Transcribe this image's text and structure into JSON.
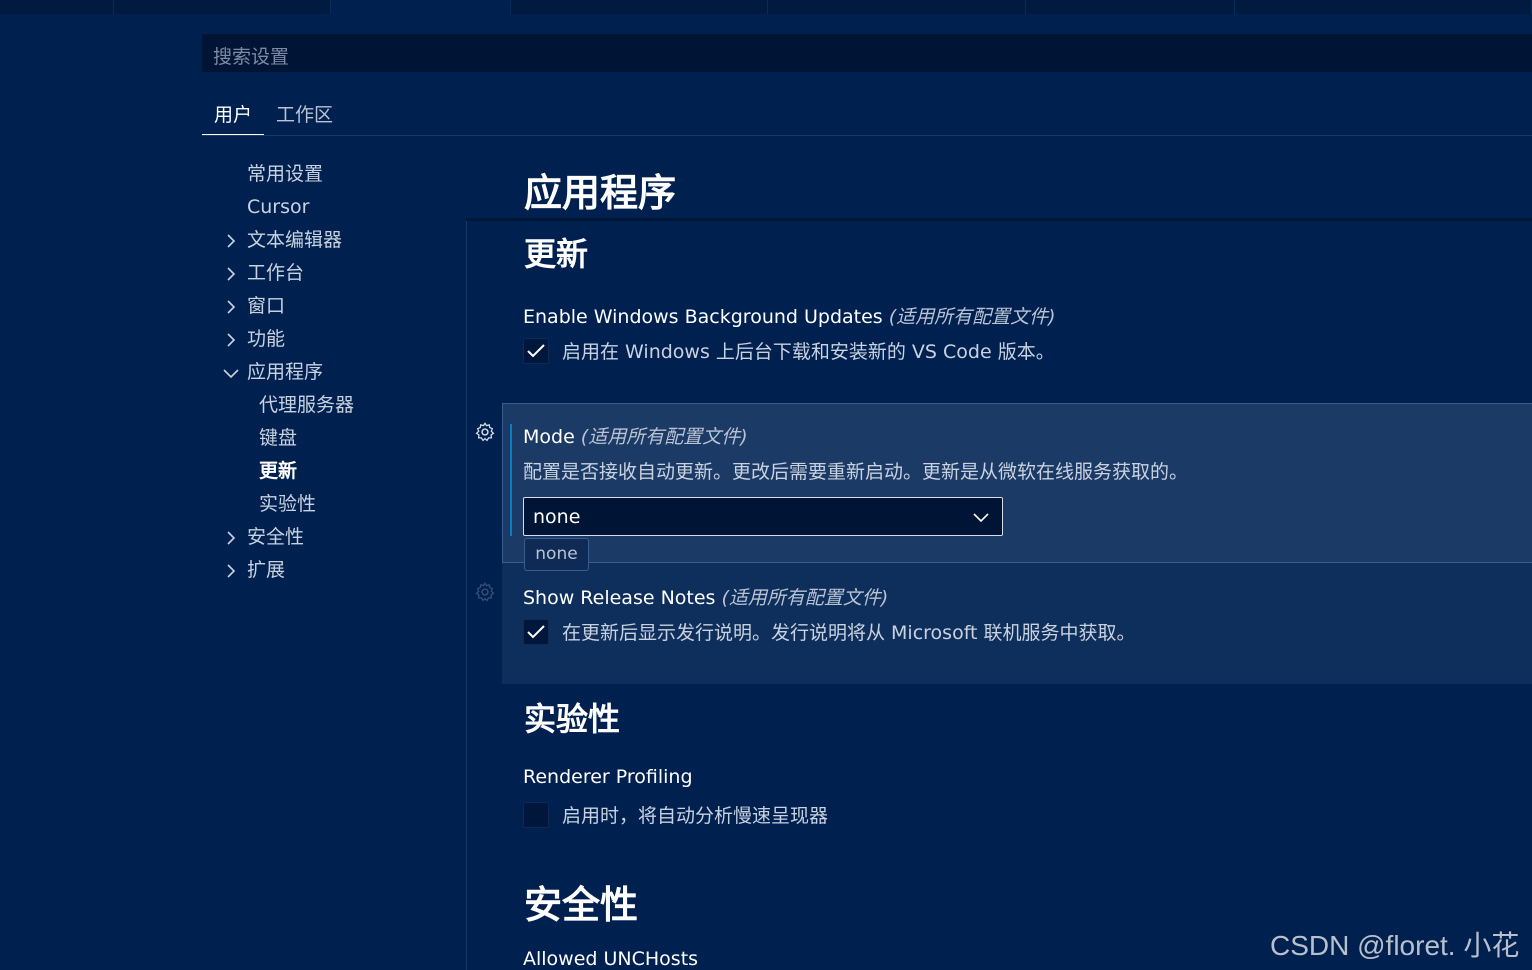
{
  "search": {
    "placeholder": "搜索设置"
  },
  "scope_tabs": [
    {
      "label": "用户",
      "active": true
    },
    {
      "label": "工作区",
      "active": false
    }
  ],
  "toc": [
    {
      "label": "常用设置",
      "chevron": "none"
    },
    {
      "label": "Cursor",
      "chevron": "none"
    },
    {
      "label": "文本编辑器",
      "chevron": "right"
    },
    {
      "label": "工作台",
      "chevron": "right"
    },
    {
      "label": "窗口",
      "chevron": "right"
    },
    {
      "label": "功能",
      "chevron": "right"
    },
    {
      "label": "应用程序",
      "chevron": "down"
    },
    {
      "label": "代理服务器",
      "child": true
    },
    {
      "label": "键盘",
      "child": true
    },
    {
      "label": "更新",
      "child": true,
      "selected": true
    },
    {
      "label": "实验性",
      "child": true
    },
    {
      "label": "安全性",
      "chevron": "right"
    },
    {
      "label": "扩展",
      "chevron": "right"
    }
  ],
  "content": {
    "heading": "应用程序",
    "section_update": "更新",
    "bg_updates": {
      "title": "Enable Windows Background Updates",
      "scope": "(适用所有配置文件)",
      "checked": true,
      "description": "启用在 Windows 上后台下载和安装新的 VS Code 版本。"
    },
    "mode": {
      "title": "Mode",
      "scope": "(适用所有配置文件)",
      "description": "配置是否接收自动更新。更改后需要重新启动。更新是从微软在线服务获取的。",
      "value": "none",
      "tooltip": "none"
    },
    "release_notes": {
      "title": "Show Release Notes",
      "scope": "(适用所有配置文件)",
      "checked": true,
      "description": "在更新后显示发行说明。发行说明将从 Microsoft 联机服务中获取。"
    },
    "section_experimental": "实验性",
    "renderer_profiling": {
      "title": "Renderer Profiling",
      "checked": false,
      "description": "启用时，将自动分析慢速呈现器"
    },
    "section_security": "安全性",
    "allowed_unc": {
      "title": "Allowed UNCHosts"
    }
  },
  "watermark": "CSDN @floret. 小花",
  "colors": {
    "background": "#00204f",
    "focus_panel": "#1c3a66",
    "focus_bar": "#0a7ec2",
    "input_bg": "#001535"
  }
}
